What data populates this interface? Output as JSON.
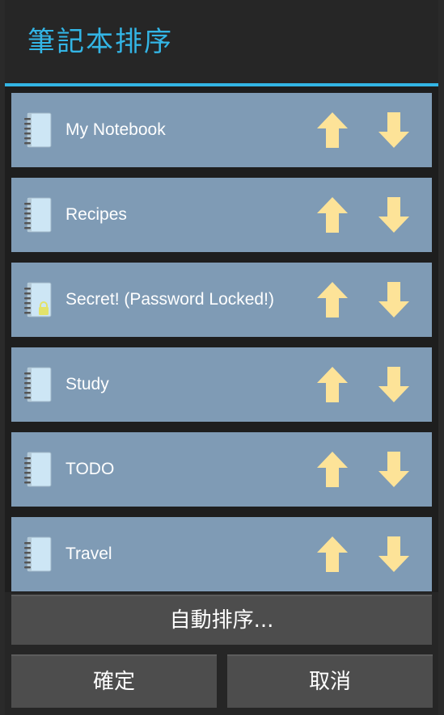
{
  "dialog": {
    "title": "筆記本排序"
  },
  "notebooks": [
    {
      "label": "My Notebook",
      "icon": "notebook-icon",
      "locked": false
    },
    {
      "label": "Recipes",
      "icon": "notebook-icon",
      "locked": false
    },
    {
      "label": "Secret! (Password Locked!)",
      "icon": "locked-notebook-icon",
      "locked": true
    },
    {
      "label": "Study",
      "icon": "notebook-icon",
      "locked": false
    },
    {
      "label": "TODO",
      "icon": "notebook-icon",
      "locked": false
    },
    {
      "label": "Travel",
      "icon": "notebook-icon",
      "locked": false
    }
  ],
  "buttons": {
    "auto_sort": "自動排序...",
    "ok": "確定",
    "cancel": "取消"
  },
  "colors": {
    "accent": "#33b5e5",
    "row_bg": "#7f9bb5",
    "arrow": "#fde398",
    "button_bg": "#4d4d4d"
  }
}
